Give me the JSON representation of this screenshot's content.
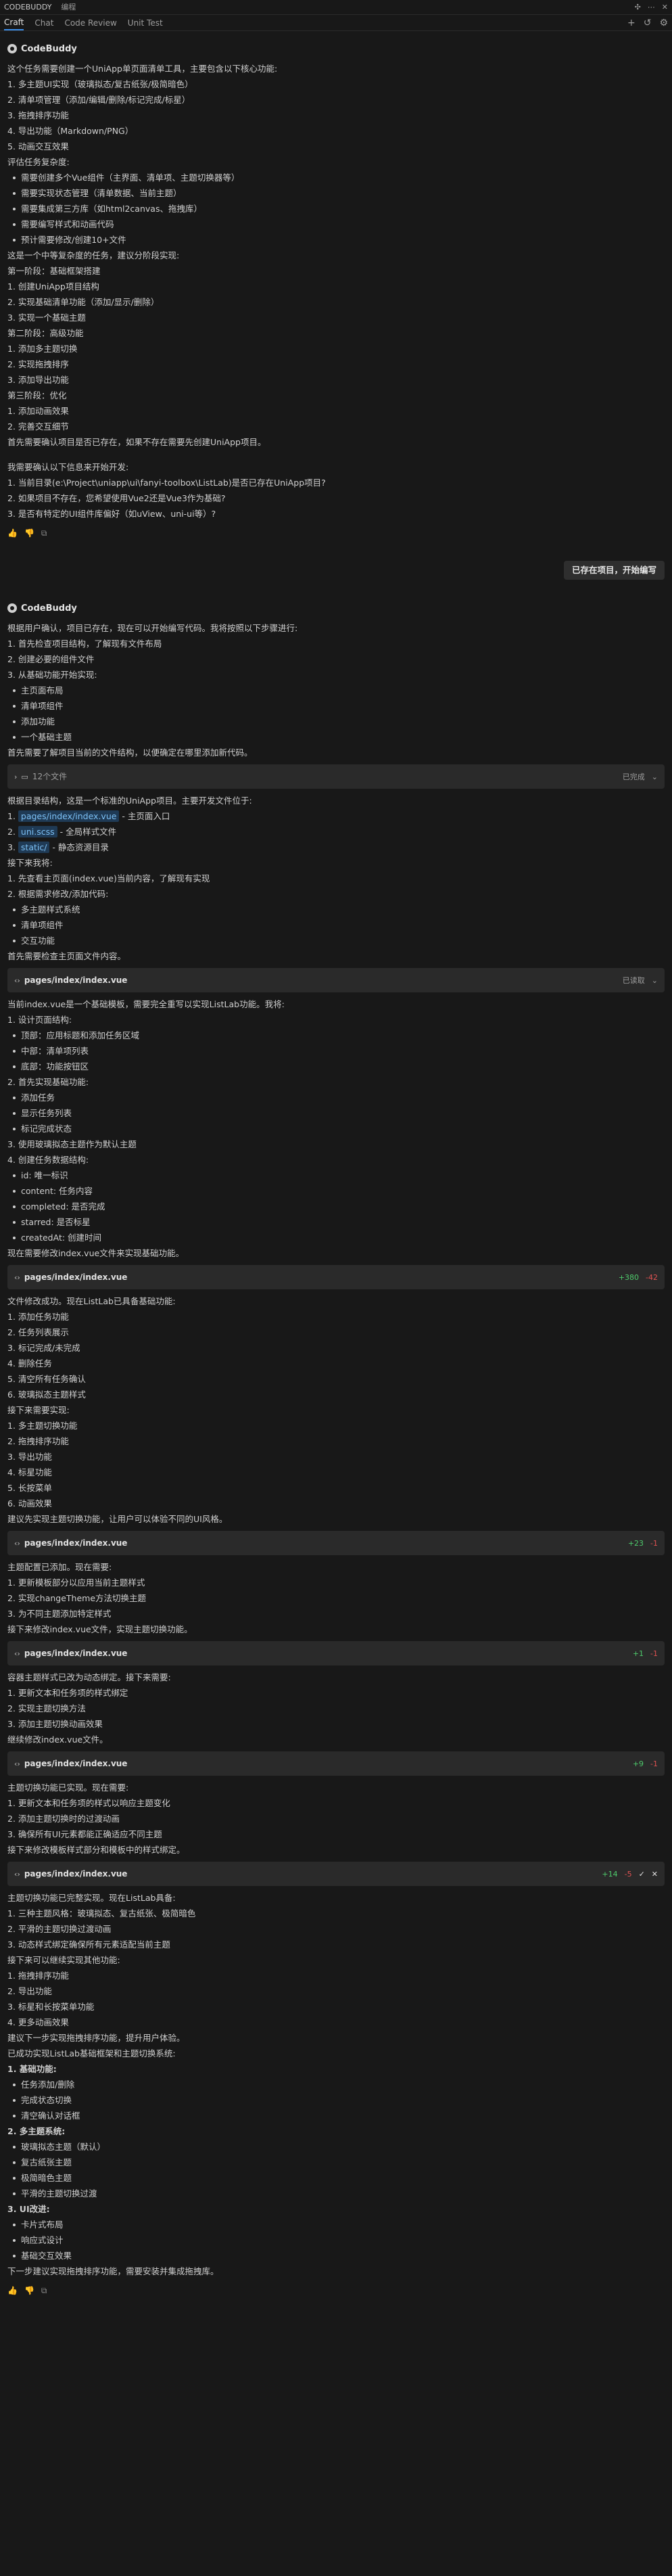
{
  "topbar": {
    "title": "CODEBUDDY",
    "menu": "编程"
  },
  "tabs": [
    "Craft",
    "Chat",
    "Code Review",
    "Unit Test"
  ],
  "agent_name": "CodeBuddy",
  "block1": [
    {
      "t": "这个任务需要创建一个UniApp单页面清单工具，主要包含以下核心功能:"
    },
    {
      "t": "1. 多主题UI实现（玻璃拟态/复古纸张/极简暗色）"
    },
    {
      "t": "2. 清单项管理（添加/编辑/删除/标记完成/标星）"
    },
    {
      "t": "3. 拖拽排序功能"
    },
    {
      "t": "4. 导出功能（Markdown/PNG）"
    },
    {
      "t": "5. 动画交互效果"
    },
    {
      "t": "评估任务复杂度:"
    },
    {
      "t": "需要创建多个Vue组件（主界面、清单项、主题切换器等）",
      "b": true
    },
    {
      "t": "需要实现状态管理（清单数据、当前主题）",
      "b": true
    },
    {
      "t": "需要集成第三方库（如html2canvas、拖拽库）",
      "b": true
    },
    {
      "t": "需要编写样式和动画代码",
      "b": true
    },
    {
      "t": "预计需要修改/创建10+文件",
      "b": true
    },
    {
      "t": "这是一个中等复杂度的任务，建议分阶段实现:"
    },
    {
      "t": "第一阶段：基础框架搭建"
    },
    {
      "t": "1. 创建UniApp项目结构"
    },
    {
      "t": "2. 实现基础清单功能（添加/显示/删除）"
    },
    {
      "t": "3. 实现一个基础主题"
    },
    {
      "t": "第二阶段：高级功能"
    },
    {
      "t": "1. 添加多主题切换"
    },
    {
      "t": "2. 实现拖拽排序"
    },
    {
      "t": "3. 添加导出功能"
    },
    {
      "t": "第三阶段：优化"
    },
    {
      "t": "1. 添加动画效果"
    },
    {
      "t": "2. 完善交互细节"
    },
    {
      "t": "首先需要确认项目是否已存在，如果不存在需要先创建UniApp项目。"
    }
  ],
  "block1b": [
    {
      "t": "我需要确认以下信息来开始开发:"
    },
    {
      "t": "1. 当前目录(e:\\Project\\uniapp\\ui\\fanyi-toolbox\\ListLab)是否已存在UniApp项目?"
    },
    {
      "t": "2. 如果项目不存在，您希望使用Vue2还是Vue3作为基础?"
    },
    {
      "t": "3. 是否有特定的UI组件库偏好（如uView、uni-ui等）?"
    }
  ],
  "feedback_icons": [
    "thumbs-up",
    "thumbs-down",
    "copy"
  ],
  "user_message": "已存在项目，开始编写",
  "block2": [
    {
      "t": "根据用户确认，项目已存在，现在可以开始编写代码。我将按照以下步骤进行:"
    },
    {
      "t": "1. 首先检查项目结构，了解现有文件布局"
    },
    {
      "t": "2. 创建必要的组件文件"
    },
    {
      "t": "3. 从基础功能开始实现:"
    },
    {
      "t": "主页面布局",
      "b": true
    },
    {
      "t": "清单项组件",
      "b": true
    },
    {
      "t": "添加功能",
      "b": true
    },
    {
      "t": "一个基础主题",
      "b": true
    },
    {
      "t": "首先需要了解项目当前的文件结构，以便确定在哪里添加新代码。"
    }
  ],
  "folder_card": {
    "label": "12个文件",
    "status": "已完成"
  },
  "block3_intro": "根据目录结构，这是一个标准的UniApp项目。主要开发文件位于:",
  "block3_files": [
    {
      "file": "pages/index/index.vue",
      "desc": " - 主页面入口"
    },
    {
      "file": "uni.scss",
      "desc": " - 全局样式文件"
    },
    {
      "file": "static/",
      "desc": " - 静态资源目录"
    }
  ],
  "block3": [
    {
      "t": "接下来我将:"
    },
    {
      "t": "1. 先查看主页面(index.vue)当前内容，了解现有实现"
    },
    {
      "t": "2. 根据需求修改/添加代码:"
    },
    {
      "t": "多主题样式系统",
      "b": true
    },
    {
      "t": "清单项组件",
      "b": true
    },
    {
      "t": "交互功能",
      "b": true
    },
    {
      "t": "首先需要检查主页面文件内容。"
    }
  ],
  "card_read": {
    "file": "pages/index/index.vue",
    "status": "已读取"
  },
  "block4": [
    {
      "t": "当前index.vue是一个基础模板，需要完全重写以实现ListLab功能。我将:"
    },
    {
      "t": "1. 设计页面结构:"
    },
    {
      "t": "顶部：应用标题和添加任务区域",
      "b": true
    },
    {
      "t": "中部：清单项列表",
      "b": true
    },
    {
      "t": "底部：功能按钮区",
      "b": true
    },
    {
      "t": "2. 首先实现基础功能:"
    },
    {
      "t": "添加任务",
      "b": true
    },
    {
      "t": "显示任务列表",
      "b": true
    },
    {
      "t": "标记完成状态",
      "b": true
    },
    {
      "t": "3. 使用玻璃拟态主题作为默认主题"
    },
    {
      "t": "4. 创建任务数据结构:"
    },
    {
      "t": "id: 唯一标识",
      "b": true
    },
    {
      "t": "content: 任务内容",
      "b": true
    },
    {
      "t": "completed: 是否完成",
      "b": true
    },
    {
      "t": "starred: 是否标星",
      "b": true
    },
    {
      "t": "createdAt: 创建时间",
      "b": true
    },
    {
      "t": "现在需要修改index.vue文件来实现基础功能。"
    }
  ],
  "card_edit1": {
    "file": "pages/index/index.vue",
    "add": "+380",
    "del": "-42"
  },
  "block5": [
    {
      "t": "文件修改成功。现在ListLab已具备基础功能:"
    },
    {
      "t": "1. 添加任务功能"
    },
    {
      "t": "2. 任务列表展示"
    },
    {
      "t": "3. 标记完成/未完成"
    },
    {
      "t": "4. 删除任务"
    },
    {
      "t": "5. 清空所有任务确认"
    },
    {
      "t": "6. 玻璃拟态主题样式"
    },
    {
      "t": "接下来需要实现:"
    },
    {
      "t": "1. 多主题切换功能"
    },
    {
      "t": "2. 拖拽排序功能"
    },
    {
      "t": "3. 导出功能"
    },
    {
      "t": "4. 标星功能"
    },
    {
      "t": "5. 长按菜单"
    },
    {
      "t": "6. 动画效果"
    },
    {
      "t": "建议先实现主题切换功能，让用户可以体验不同的UI风格。"
    }
  ],
  "card_edit2": {
    "file": "pages/index/index.vue",
    "add": "+23",
    "del": "-1"
  },
  "block6": [
    {
      "t": "主题配置已添加。现在需要:"
    },
    {
      "t": "1. 更新模板部分以应用当前主题样式"
    },
    {
      "t": "2. 实现changeTheme方法切换主题"
    },
    {
      "t": "3. 为不同主题添加特定样式"
    },
    {
      "t": "接下来修改index.vue文件，实现主题切换功能。"
    }
  ],
  "card_edit3": {
    "file": "pages/index/index.vue",
    "add": "+1",
    "del": "-1"
  },
  "block7": [
    {
      "t": "容器主题样式已改为动态绑定。接下来需要:"
    },
    {
      "t": "1. 更新文本和任务项的样式绑定"
    },
    {
      "t": "2. 实现主题切换方法"
    },
    {
      "t": "3. 添加主题切换动画效果"
    },
    {
      "t": "继续修改index.vue文件。"
    }
  ],
  "card_edit4": {
    "file": "pages/index/index.vue",
    "add": "+9",
    "del": "-1"
  },
  "block8": [
    {
      "t": "主题切换功能已实现。现在需要:"
    },
    {
      "t": "1. 更新文本和任务项的样式以响应主题变化"
    },
    {
      "t": "2. 添加主题切换时的过渡动画"
    },
    {
      "t": "3. 确保所有UI元素都能正确适应不同主题"
    },
    {
      "t": "接下来修改模板样式部分和模板中的样式绑定。"
    }
  ],
  "card_edit5": {
    "file": "pages/index/index.vue",
    "add": "+14",
    "del": "-5"
  },
  "block9": [
    {
      "t": "主题切换功能已完整实现。现在ListLab具备:"
    },
    {
      "t": "1. 三种主题风格：玻璃拟态、复古纸张、极简暗色"
    },
    {
      "t": "2. 平滑的主题切换过渡动画"
    },
    {
      "t": "3. 动态样式绑定确保所有元素适配当前主题"
    },
    {
      "t": "接下来可以继续实现其他功能:"
    },
    {
      "t": "1. 拖拽排序功能"
    },
    {
      "t": "2. 导出功能"
    },
    {
      "t": "3. 标星和长按菜单功能"
    },
    {
      "t": "4. 更多动画效果"
    },
    {
      "t": "建议下一步实现拖拽排序功能，提升用户体验。"
    },
    {
      "t": "已成功实现ListLab基础框架和主题切换系统:"
    },
    {
      "t": "1. 基础功能:",
      "bold": true
    },
    {
      "t": "任务添加/删除",
      "b": true
    },
    {
      "t": "完成状态切换",
      "b": true
    },
    {
      "t": "清空确认对话框",
      "b": true
    },
    {
      "t": "2. 多主题系统:",
      "bold": true
    },
    {
      "t": "玻璃拟态主题（默认）",
      "b": true
    },
    {
      "t": "复古纸张主题",
      "b": true
    },
    {
      "t": "极简暗色主题",
      "b": true
    },
    {
      "t": "平滑的主题切换过渡",
      "b": true
    },
    {
      "t": "3. UI改进:",
      "bold": true
    },
    {
      "t": "卡片式布局",
      "b": true
    },
    {
      "t": "响应式设计",
      "b": true
    },
    {
      "t": "基础交互效果",
      "b": true
    },
    {
      "t": "下一步建议实现拖拽排序功能，需要安装并集成拖拽库。"
    }
  ]
}
